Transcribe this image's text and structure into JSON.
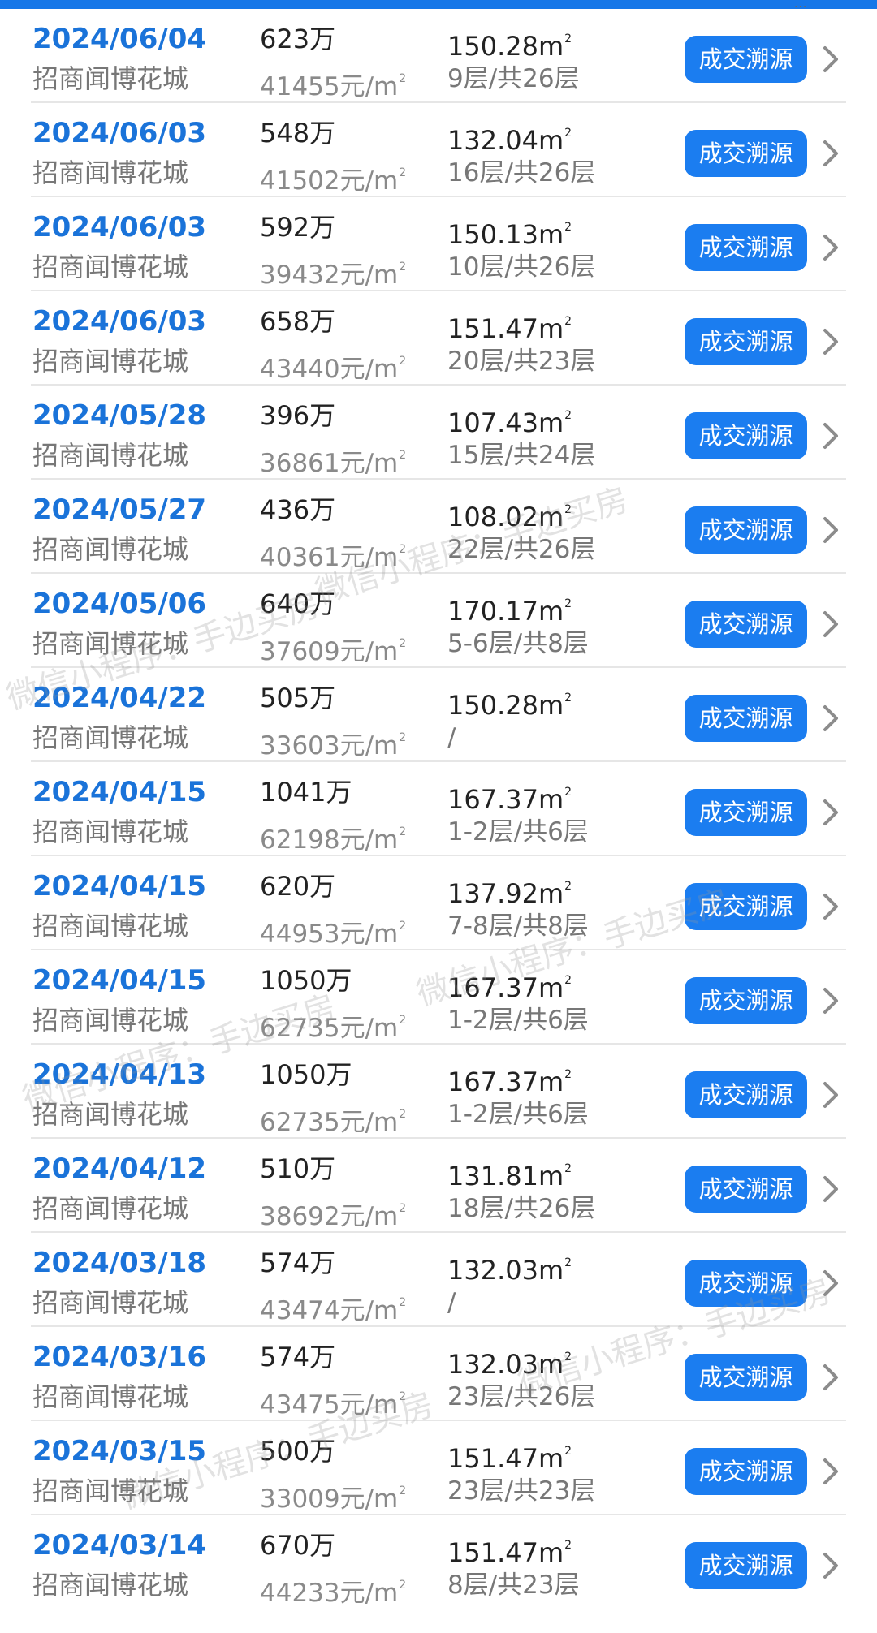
{
  "button_label": "成交溯源",
  "accent_color": "#1b7df0",
  "watermark_text": "微信小程序：手边买房",
  "transactions": [
    {
      "date": "2024/06/04",
      "community": "招商闻博花城",
      "price": "623万",
      "unit_price": "41455元/m",
      "area": "150.28m",
      "floor": "9层/共26层"
    },
    {
      "date": "2024/06/03",
      "community": "招商闻博花城",
      "price": "548万",
      "unit_price": "41502元/m",
      "area": "132.04m",
      "floor": "16层/共26层"
    },
    {
      "date": "2024/06/03",
      "community": "招商闻博花城",
      "price": "592万",
      "unit_price": "39432元/m",
      "area": "150.13m",
      "floor": "10层/共26层"
    },
    {
      "date": "2024/06/03",
      "community": "招商闻博花城",
      "price": "658万",
      "unit_price": "43440元/m",
      "area": "151.47m",
      "floor": "20层/共23层"
    },
    {
      "date": "2024/05/28",
      "community": "招商闻博花城",
      "price": "396万",
      "unit_price": "36861元/m",
      "area": "107.43m",
      "floor": "15层/共24层"
    },
    {
      "date": "2024/05/27",
      "community": "招商闻博花城",
      "price": "436万",
      "unit_price": "40361元/m",
      "area": "108.02m",
      "floor": "22层/共26层"
    },
    {
      "date": "2024/05/06",
      "community": "招商闻博花城",
      "price": "640万",
      "unit_price": "37609元/m",
      "area": "170.17m",
      "floor": "5-6层/共8层"
    },
    {
      "date": "2024/04/22",
      "community": "招商闻博花城",
      "price": "505万",
      "unit_price": "33603元/m",
      "area": "150.28m",
      "floor": "/"
    },
    {
      "date": "2024/04/15",
      "community": "招商闻博花城",
      "price": "1041万",
      "unit_price": "62198元/m",
      "area": "167.37m",
      "floor": "1-2层/共6层"
    },
    {
      "date": "2024/04/15",
      "community": "招商闻博花城",
      "price": "620万",
      "unit_price": "44953元/m",
      "area": "137.92m",
      "floor": "7-8层/共8层"
    },
    {
      "date": "2024/04/15",
      "community": "招商闻博花城",
      "price": "1050万",
      "unit_price": "62735元/m",
      "area": "167.37m",
      "floor": "1-2层/共6层"
    },
    {
      "date": "2024/04/13",
      "community": "招商闻博花城",
      "price": "1050万",
      "unit_price": "62735元/m",
      "area": "167.37m",
      "floor": "1-2层/共6层"
    },
    {
      "date": "2024/04/12",
      "community": "招商闻博花城",
      "price": "510万",
      "unit_price": "38692元/m",
      "area": "131.81m",
      "floor": "18层/共26层"
    },
    {
      "date": "2024/03/18",
      "community": "招商闻博花城",
      "price": "574万",
      "unit_price": "43474元/m",
      "area": "132.03m",
      "floor": "/"
    },
    {
      "date": "2024/03/16",
      "community": "招商闻博花城",
      "price": "574万",
      "unit_price": "43475元/m",
      "area": "132.03m",
      "floor": "23层/共26层"
    },
    {
      "date": "2024/03/15",
      "community": "招商闻博花城",
      "price": "500万",
      "unit_price": "33009元/m",
      "area": "151.47m",
      "floor": "23层/共23层"
    },
    {
      "date": "2024/03/14",
      "community": "招商闻博花城",
      "price": "670万",
      "unit_price": "44233元/m",
      "area": "151.47m",
      "floor": "8层/共23层"
    }
  ]
}
